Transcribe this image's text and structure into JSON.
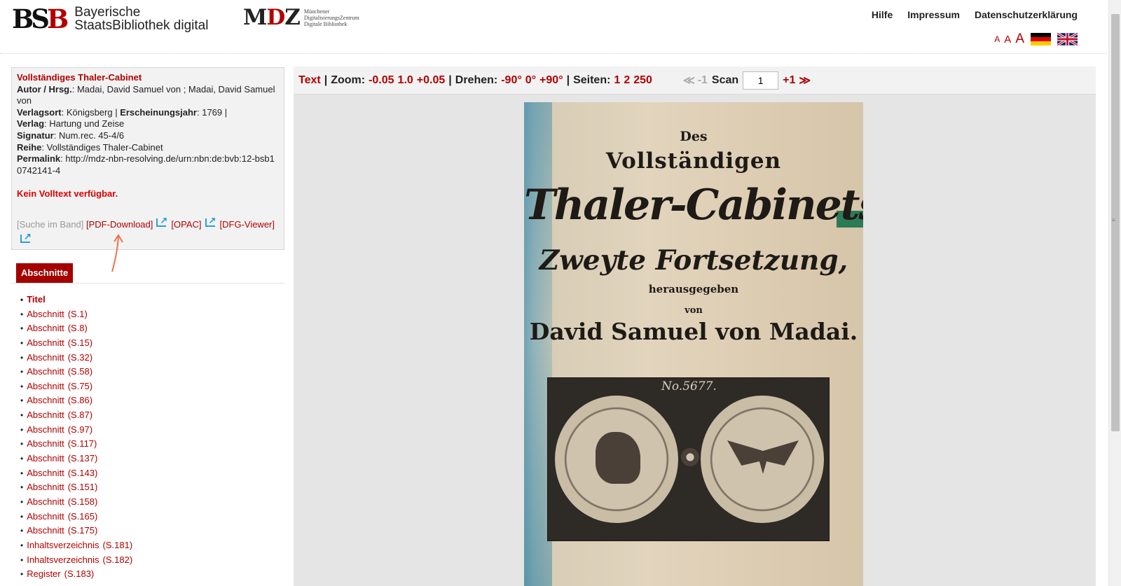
{
  "header": {
    "bsb_logo": {
      "mark_1": "BS",
      "mark_2": "B",
      "line1": "Bayerische",
      "line2": "StaatsBibliothek digital"
    },
    "mdz_logo": {
      "mark_1": "M",
      "mark_2": "D",
      "mark_3": "Z",
      "line1": "Münchener",
      "line2": "DigitalisierungsZentrum",
      "line3": "Digitale Bibliothek"
    },
    "nav": {
      "help": "Hilfe",
      "imprint": "Impressum",
      "privacy": "Datenschutzerklärung"
    },
    "font_sizes": [
      "A",
      "A",
      "A"
    ],
    "flags": {
      "german": "flag-de",
      "english": "flag-uk"
    }
  },
  "info": {
    "title": "Vollständiges Thaler-Cabinet",
    "author_label": "Autor / Hrsg.",
    "author": ": Madai, David Samuel von ; Madai, David Samuel von",
    "place_label": "Verlagsort",
    "place": ": Königsberg | ",
    "year_label": "Erscheinungsjahr",
    "year": ": 1769 |",
    "publisher_label": "Verlag",
    "publisher": ": Hartung und Zeise",
    "signature_label": "Signatur",
    "signature": ": Num.rec. 45-4/6",
    "series_label": "Reihe",
    "series": ": Vollständiges Thaler-Cabinet",
    "permalink_label": "Permalink",
    "permalink": ": http://mdz-nbn-resolving.de/urn:nbn:de:bvb:12-bsb10742141-4",
    "no_fulltext": "Kein Volltext verfügbar.",
    "links": {
      "search": "[Suche im Band]",
      "pdf": "[PDF-Download]",
      "opac": "[OPAC]",
      "dfg": "[DFG-Viewer]"
    }
  },
  "sections": {
    "tab_label": "Abschnitte",
    "items": [
      {
        "label": "Titel",
        "page": ""
      },
      {
        "label": "Abschnitt",
        "page": "(S.1)"
      },
      {
        "label": "Abschnitt",
        "page": "(S.8)"
      },
      {
        "label": "Abschnitt",
        "page": "(S.15)"
      },
      {
        "label": "Abschnitt",
        "page": "(S.32)"
      },
      {
        "label": "Abschnitt",
        "page": "(S.58)"
      },
      {
        "label": "Abschnitt",
        "page": "(S.75)"
      },
      {
        "label": "Abschnitt",
        "page": "(S.86)"
      },
      {
        "label": "Abschnitt",
        "page": "(S.87)"
      },
      {
        "label": "Abschnitt",
        "page": "(S.97)"
      },
      {
        "label": "Abschnitt",
        "page": "(S.117)"
      },
      {
        "label": "Abschnitt",
        "page": "(S.137)"
      },
      {
        "label": "Abschnitt",
        "page": "(S.143)"
      },
      {
        "label": "Abschnitt",
        "page": "(S.151)"
      },
      {
        "label": "Abschnitt",
        "page": "(S.158)"
      },
      {
        "label": "Abschnitt",
        "page": "(S.165)"
      },
      {
        "label": "Abschnitt",
        "page": "(S.175)"
      },
      {
        "label": "Inhaltsverzeichnis",
        "page": "(S.181)"
      },
      {
        "label": "Inhaltsverzeichnis",
        "page": "(S.182)"
      },
      {
        "label": "Register",
        "page": "(S.183)"
      }
    ]
  },
  "viewer": {
    "text_link": "Text",
    "zoom_label": "Zoom:",
    "zoom_out": "-0.05",
    "zoom_reset": "1.0",
    "zoom_in": "+0.05",
    "rotate_label": "Drehen:",
    "rotate_left": "-90°",
    "rotate_zero": "0°",
    "rotate_right": "+90°",
    "pages_label": "Seiten:",
    "pages_1": "1",
    "pages_2": "2",
    "pages_250": "250",
    "first": "K",
    "prev": "-1",
    "scan_label": "Scan",
    "scan_value": "1",
    "next": "+1",
    "last": "»",
    "scan_text": {
      "des": "Des",
      "vollst": "Vollständigen",
      "thaler": "Thaler-Cabinets",
      "zweyte": "Zweyte Fortsetzung,",
      "herausg": "herausgegeben",
      "von": "von",
      "author": "David Samuel von Madai.",
      "coin_number": "No.5677."
    }
  },
  "colors": {
    "accent": "#b20000",
    "tab": "#a40000",
    "link_icon": "#2a9fd8",
    "annotation": "#f07050"
  }
}
